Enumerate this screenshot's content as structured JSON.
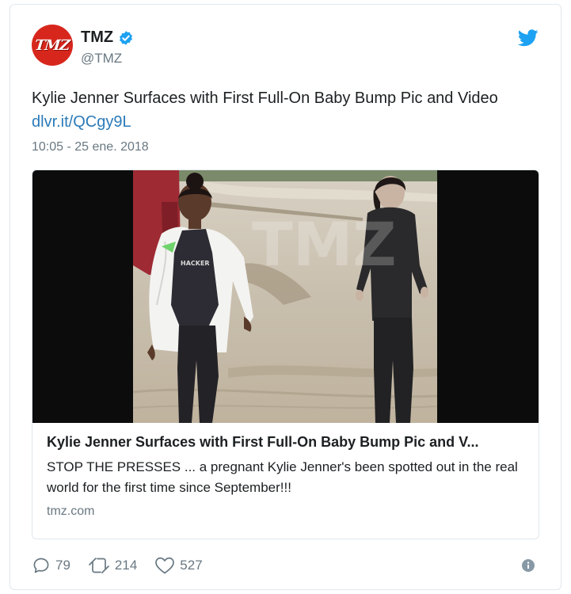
{
  "author": {
    "display_name": "TMZ",
    "handle": "@TMZ",
    "avatar_text": "TMZ",
    "verified": true,
    "verified_icon": "verified-badge-icon"
  },
  "brand_icon": "twitter-bird-icon",
  "tweet": {
    "text": "Kylie Jenner Surfaces with First Full-On Baby Bump Pic and Video ",
    "link_text": "dlvr.it/QCgy9L",
    "timestamp": "10:05 - 25 ene. 2018"
  },
  "card": {
    "title": "Kylie Jenner Surfaces with First Full-On Baby Bump Pic and V...",
    "description": "STOP THE PRESSES ... a pregnant Kylie Jenner's been spotted out in the real world for the first time since September!!!",
    "domain": "tmz.com",
    "image_watermark": "TMZ",
    "shirt_text": "HACKER"
  },
  "actions": {
    "replies": "79",
    "retweets": "214",
    "likes": "527"
  },
  "colors": {
    "link": "#2b7bb9",
    "brand_blue": "#1da1f2",
    "muted": "#697882",
    "avatar_red": "#d7271d"
  }
}
